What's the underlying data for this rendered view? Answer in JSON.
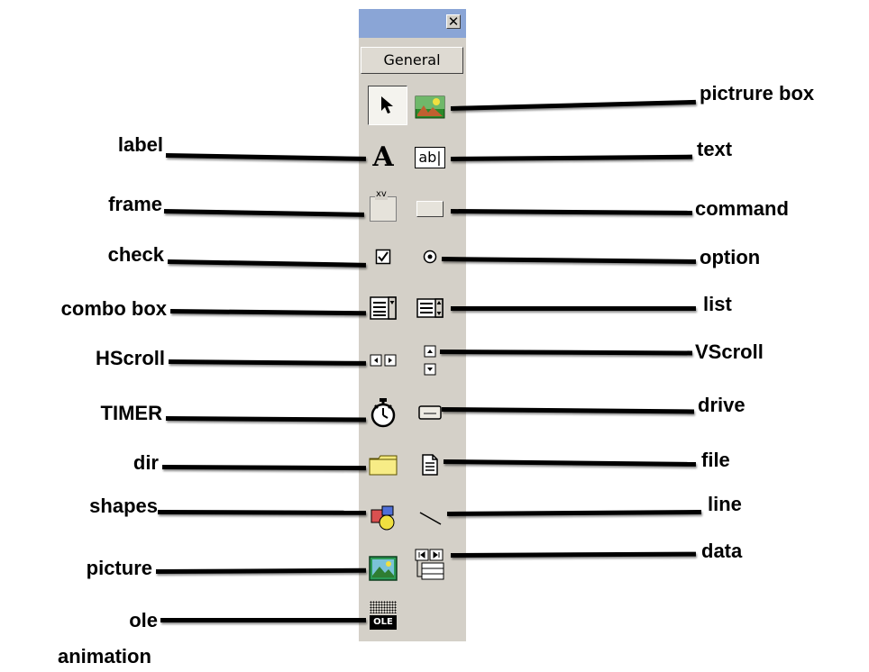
{
  "toolbox": {
    "close_glyph": "✕",
    "tab_label": "General",
    "titlebar_color": "#8aa5d6",
    "panel_color": "#d4d0c8"
  },
  "tools": [
    {
      "name": "pointer",
      "icon": "arrow-pointer-icon"
    },
    {
      "name": "picture box",
      "icon": "picturebox-icon"
    },
    {
      "name": "label",
      "icon": "label-A-icon",
      "glyph": "A"
    },
    {
      "name": "text",
      "icon": "textbox-icon",
      "glyph": "ab|"
    },
    {
      "name": "frame",
      "icon": "frame-icon",
      "glyph": "xv"
    },
    {
      "name": "command",
      "icon": "command-button-icon"
    },
    {
      "name": "check",
      "icon": "checkbox-icon"
    },
    {
      "name": "option",
      "icon": "option-radio-icon"
    },
    {
      "name": "combo box",
      "icon": "combobox-icon"
    },
    {
      "name": "list",
      "icon": "listbox-icon"
    },
    {
      "name": "HScroll",
      "icon": "hscroll-icon"
    },
    {
      "name": "VScroll",
      "icon": "vscroll-icon"
    },
    {
      "name": "TIMER",
      "icon": "stopwatch-icon"
    },
    {
      "name": "drive",
      "icon": "drive-icon"
    },
    {
      "name": "dir",
      "icon": "folder-icon"
    },
    {
      "name": "file",
      "icon": "file-icon"
    },
    {
      "name": "shapes",
      "icon": "shapes-icon"
    },
    {
      "name": "line",
      "icon": "line-icon"
    },
    {
      "name": "picture",
      "icon": "image-icon"
    },
    {
      "name": "data",
      "icon": "data-control-icon"
    },
    {
      "name": "ole",
      "icon": "ole-icon",
      "glyph": "OLE"
    }
  ],
  "labels": {
    "left": [
      "label",
      "frame",
      "check",
      "combo box",
      "HScroll",
      "TIMER",
      "dir",
      "shapes",
      "picture",
      "ole",
      "animation"
    ],
    "right": [
      "pictrure box",
      "text",
      "command",
      "option",
      "list",
      "VScroll",
      "drive",
      "file",
      "line",
      "data"
    ]
  }
}
